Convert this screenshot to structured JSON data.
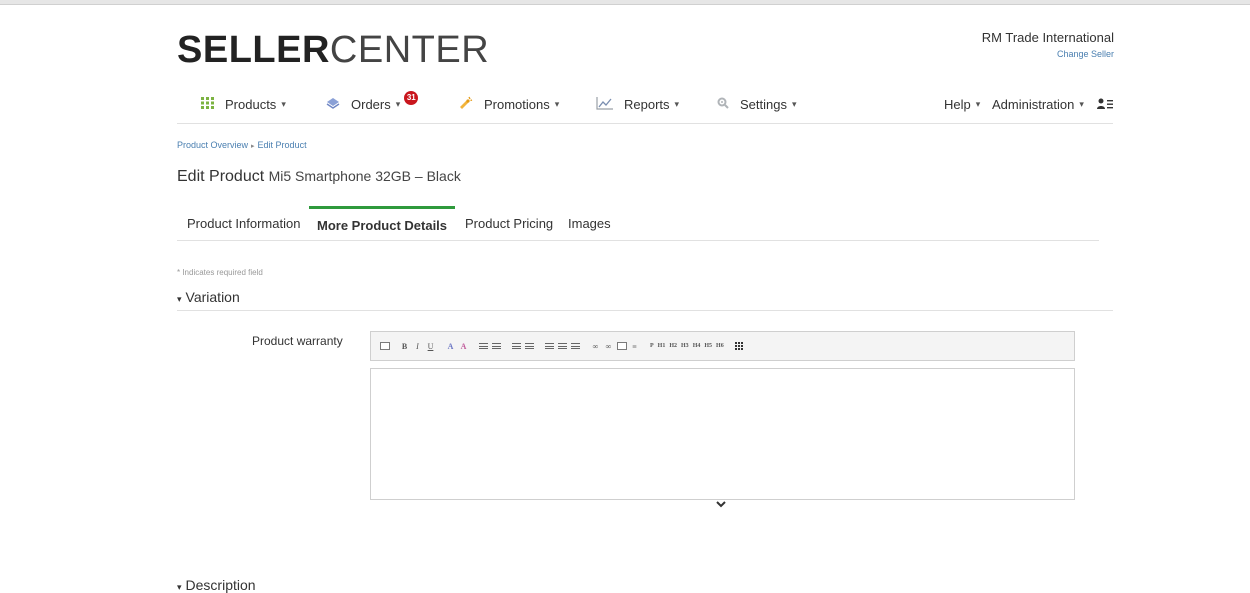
{
  "brand": {
    "bold": "SELLER",
    "light": "CENTER"
  },
  "seller": {
    "name": "RM Trade International",
    "change_label": "Change Seller"
  },
  "nav": {
    "products": "Products",
    "orders": "Orders",
    "orders_badge": "31",
    "promotions": "Promotions",
    "reports": "Reports",
    "settings": "Settings",
    "help": "Help",
    "administration": "Administration"
  },
  "breadcrumb": {
    "parent": "Product Overview",
    "current": "Edit Product"
  },
  "page": {
    "title": "Edit Product",
    "product_name": "Mi5 Smartphone 32GB – Black"
  },
  "tabs": [
    {
      "label": "Product Information"
    },
    {
      "label": "More Product Details"
    },
    {
      "label": "Product Pricing"
    },
    {
      "label": "Images"
    }
  ],
  "form": {
    "required_note": "* Indicates required field",
    "variation_label": "Variation",
    "warranty_label": "Product warranty",
    "description_label": "Description"
  },
  "toolbar": {
    "bold": "B",
    "italic": "I",
    "underline": "U",
    "p": "P",
    "h1": "H1",
    "h2": "H2",
    "h3": "H3",
    "h4": "H4",
    "h5": "H5",
    "h6": "H6"
  },
  "colors": {
    "accent_green": "#2e9a3c",
    "badge_red": "#c9161d",
    "link_blue": "#4a7fb0"
  }
}
